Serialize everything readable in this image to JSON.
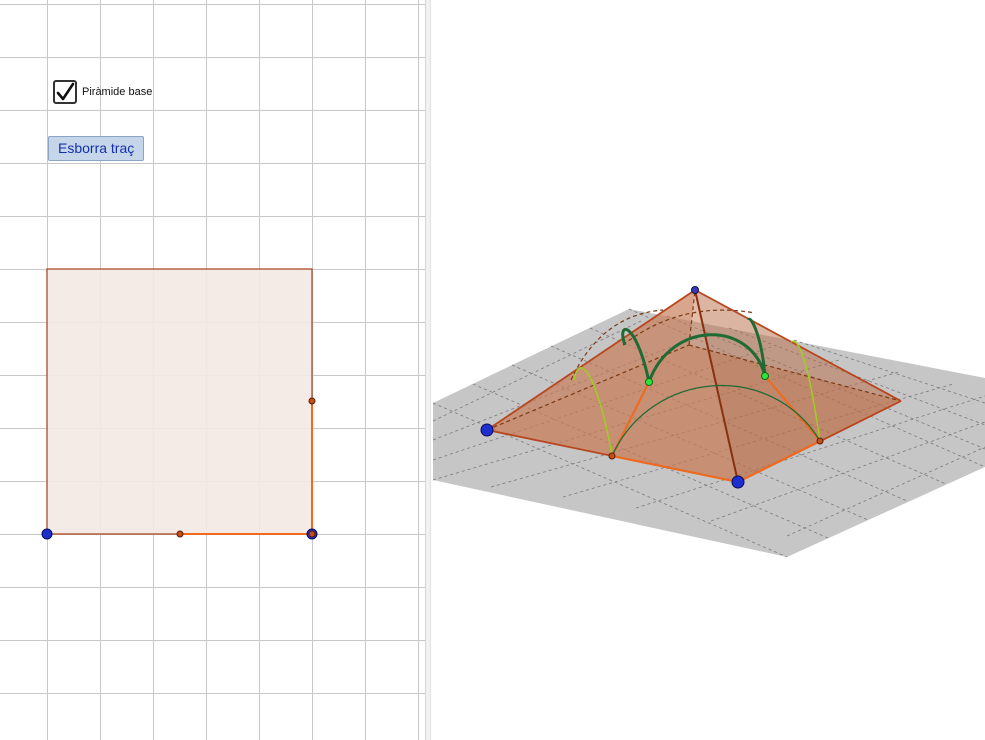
{
  "checkbox": {
    "label": "Piràmide base",
    "checked": true
  },
  "button": {
    "label": "Esborra traç"
  },
  "icons": {
    "checkbox_mark": "checkmark-icon"
  },
  "colors": {
    "grid": "#c8c8c8",
    "square_fill": "#f3e8e3",
    "square_stroke": "#a83d1a",
    "point_blue": "#1e2fd0",
    "point_orange": "#c2501c",
    "plane": "#c6c6c6",
    "pyramid_face": "#c87a55",
    "edge": "#b8461f",
    "arc_dark": "#1f6b34",
    "arc_light": "#9ccf1f",
    "highlight": "#f06a1e",
    "point_green": "#2ee63a"
  }
}
